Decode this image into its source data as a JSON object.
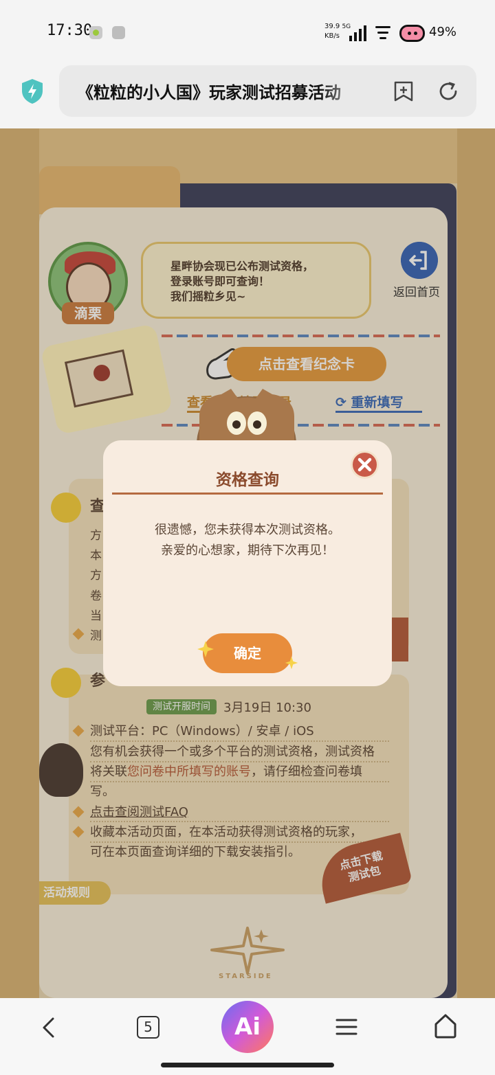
{
  "status_bar": {
    "time": "17:30",
    "net_speed_value": "39.9",
    "net_speed_unit": "KB/s",
    "network": "5G",
    "battery": "49%"
  },
  "browser": {
    "url_title": "《粒粒的小人国》玩家测试招募活动",
    "tab_count": "5",
    "ai_label": "Ai"
  },
  "page": {
    "speech": "星畔协会现已公布测试资格，\n登录账号即可查询！\n我们摇粒乡见~",
    "npc_name": "滴栗",
    "back_home": "返回首页",
    "memorial_button": "点击查看纪念卡",
    "view_record": "查看问卷填写记录",
    "refill": "重新填写",
    "section1": {
      "title": "查",
      "lines": [
        "方",
        "本",
        "方",
        "卷",
        "当",
        "测"
      ]
    },
    "section2": {
      "title": "参",
      "server_badge": "测试开服时间",
      "server_time": "3月19日  10:30",
      "platform": "测试平台：PC（Windows）/ 安卓 / iOS",
      "desc_line1": "您有机会获得一个或多个平台的测试资格，测试资格",
      "desc_pre": "将关联",
      "desc_highlight": "您问卷中所填写的账号",
      "desc_post": "，请仔细检查问卷填",
      "desc_line3": "写。",
      "faq": "点击查阅测试FAQ",
      "collect_line1": "收藏本活动页面，在本活动获得测试资格的玩家，",
      "collect_line2": "可在本页面查询详细的下载安装指引。",
      "download": "点击下载\n测试包"
    },
    "rules_tab": "活动规则",
    "logo_text": "STARSIDE"
  },
  "modal": {
    "title": "资格查询",
    "message_line1": "很遗憾，您未获得本次测试资格。",
    "message_line2": "亲爱的心想家，期待下次再见！",
    "confirm": "确定"
  }
}
